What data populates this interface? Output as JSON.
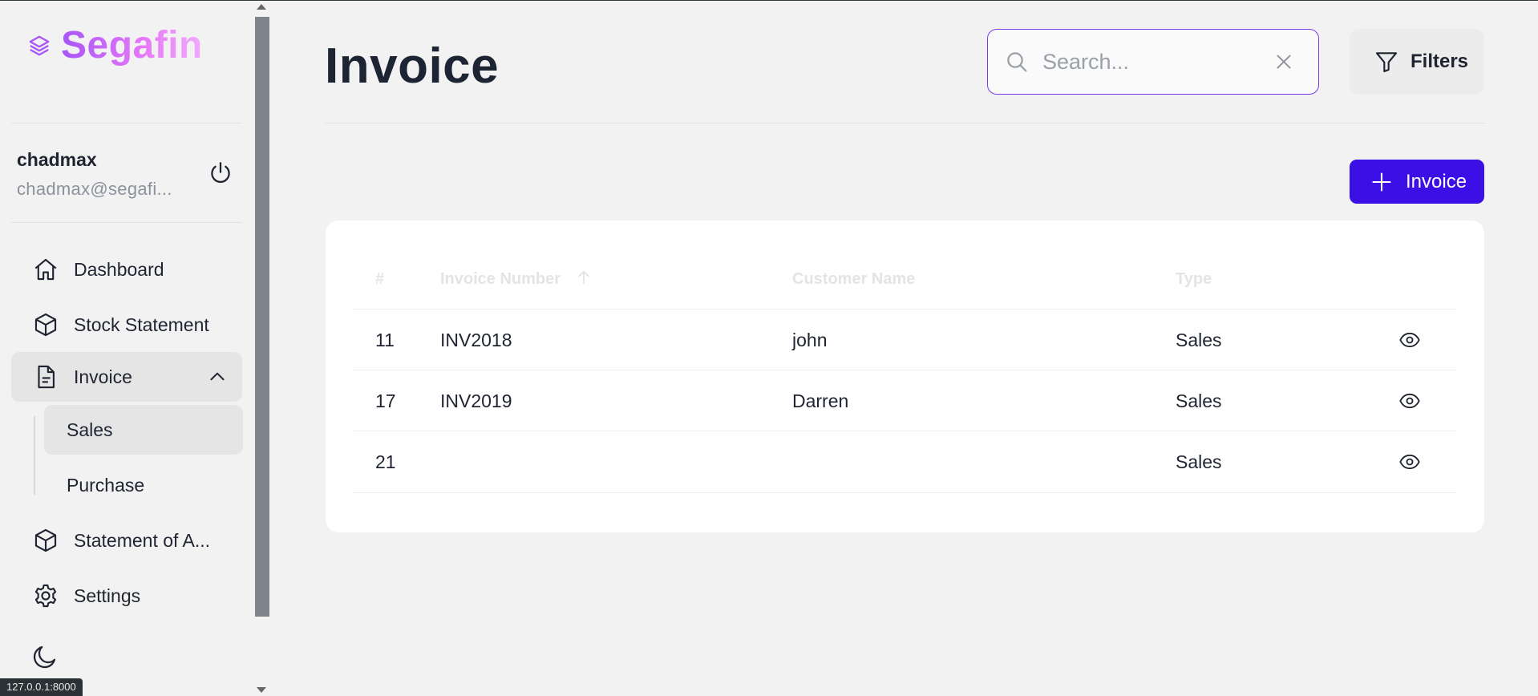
{
  "app": {
    "name": "Segafin"
  },
  "user": {
    "name": "chadmax",
    "email": "chadmax@segafi..."
  },
  "nav": {
    "dashboard": "Dashboard",
    "stock_statement": "Stock Statement",
    "invoice": "Invoice",
    "invoice_sub": {
      "sales": "Sales",
      "purchase": "Purchase"
    },
    "statement_of_accounts": "Statement of A...",
    "settings": "Settings"
  },
  "page": {
    "title": "Invoice"
  },
  "search": {
    "placeholder": "Search...",
    "value": ""
  },
  "toolbar": {
    "filters_label": "Filters",
    "add_label": "Invoice"
  },
  "table": {
    "headers": {
      "id": "#",
      "invoice_number": "Invoice Number",
      "customer_name": "Customer Name",
      "type": "Type"
    },
    "rows": [
      {
        "id": "11",
        "invoice_number": "INV2018",
        "customer_name": "john",
        "type": "Sales"
      },
      {
        "id": "17",
        "invoice_number": "INV2019",
        "customer_name": "Darren",
        "type": "Sales"
      },
      {
        "id": "21",
        "invoice_number": "",
        "customer_name": "",
        "type": "Sales"
      }
    ]
  },
  "status_bar": {
    "url": "127.0.0.1:8000"
  },
  "colors": {
    "accent": "#3b0fe6",
    "search_border": "#7c3aed",
    "logo_gradient_start": "#a855f7",
    "logo_gradient_end": "#f0abfc"
  },
  "icons": {
    "logo": "layers-icon",
    "power": "power-icon",
    "dashboard": "home-icon",
    "stock": "cube-icon",
    "invoice": "document-icon",
    "statement": "cube-icon",
    "settings": "gear-icon",
    "theme": "moon-icon",
    "search": "search-icon",
    "clear": "close-icon",
    "filters": "filter-icon",
    "add": "plus-icon",
    "view": "eye-icon",
    "sort": "arrow-up-icon",
    "collapse": "chevron-up-icon"
  }
}
